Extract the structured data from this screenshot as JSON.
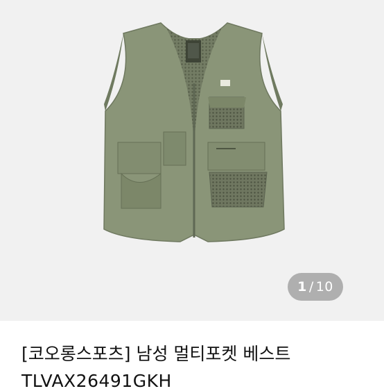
{
  "gallery": {
    "current": "1",
    "separator": "/",
    "total": "10",
    "background_color": "#f1f1f1",
    "product_color": "#8a9578"
  },
  "product": {
    "title": "[코오롱스포츠] 남성 멀티포켓 베스트",
    "code": "TLVAX26491GKH"
  }
}
